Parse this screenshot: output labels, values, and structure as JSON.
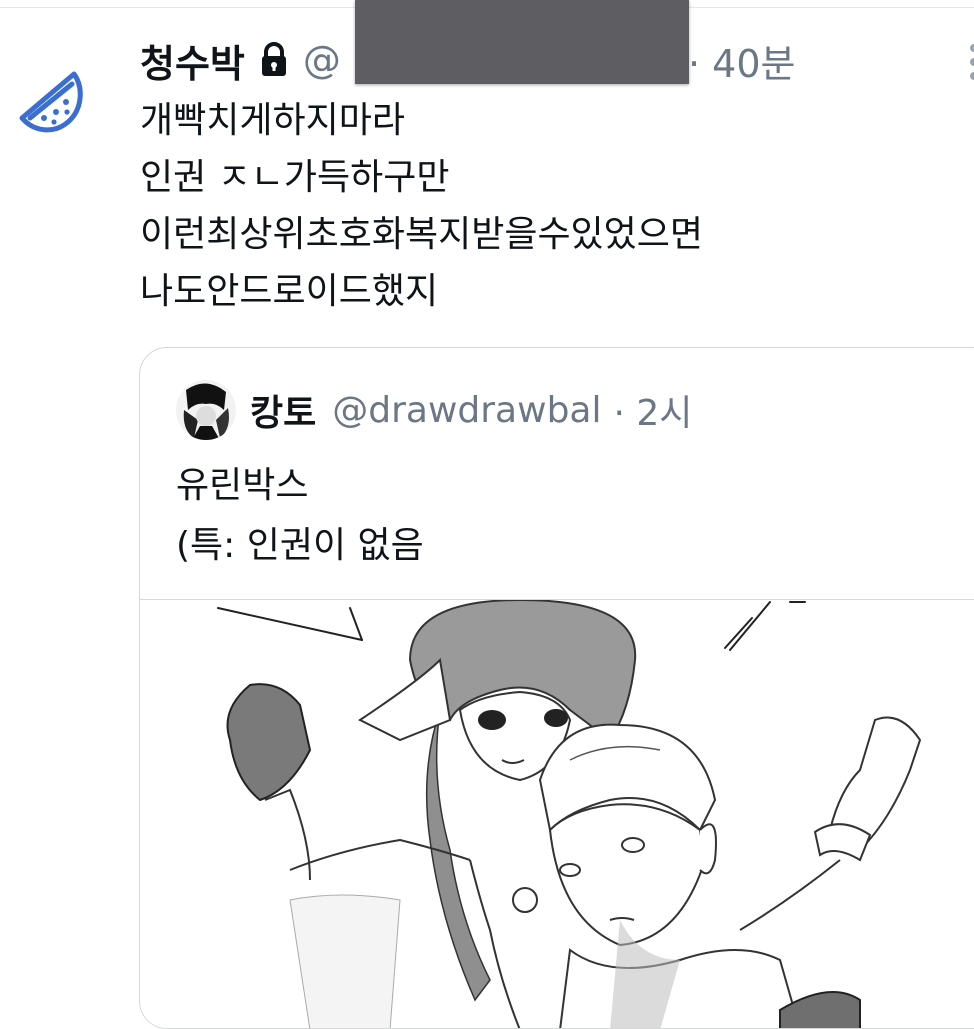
{
  "tweet": {
    "display_name": "청수박",
    "handle": "@",
    "separator_time": "· 40분",
    "text_lines": [
      "개빡치게하지마라",
      "인권 ㅈㄴ가득하구만",
      "이런최상위초호화복지받을수있었으면",
      "나도안드로이드했지"
    ]
  },
  "quoted": {
    "display_name": "캉토",
    "handle": "@drawdrawbal",
    "time": "· 2시",
    "text_lines": [
      "유린박스",
      "(특: 인권이 없음"
    ]
  },
  "icons": {
    "avatar": "watermelon-icon",
    "lock": "lock-icon",
    "more": "more-options-icon"
  },
  "colors": {
    "text": "#0f1419",
    "secondary": "#6b7785",
    "border": "#d3d8dc",
    "avatar_blue": "#3a6fd1"
  }
}
